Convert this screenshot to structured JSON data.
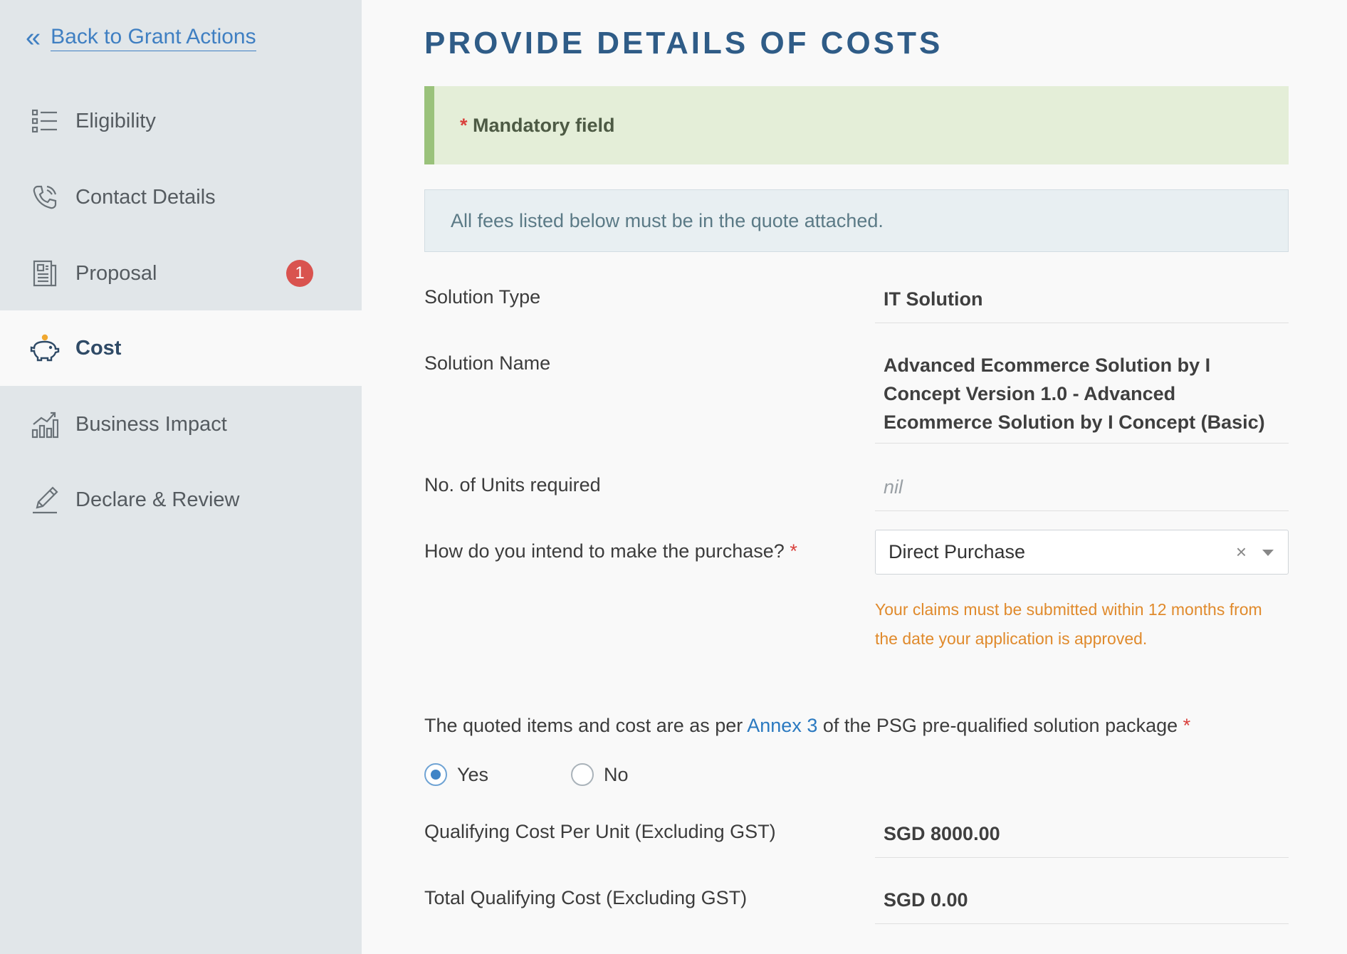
{
  "sidebar": {
    "back_label": "Back to Grant Actions",
    "items": [
      {
        "label": "Eligibility",
        "icon": "list-icon"
      },
      {
        "label": "Contact Details",
        "icon": "phone-icon"
      },
      {
        "label": "Proposal",
        "icon": "document-icon",
        "badge": "1"
      },
      {
        "label": "Cost",
        "icon": "piggy-bank-icon",
        "active": true
      },
      {
        "label": "Business Impact",
        "icon": "bar-chart-icon"
      },
      {
        "label": "Declare & Review",
        "icon": "pen-icon"
      }
    ]
  },
  "main": {
    "title": "PROVIDE DETAILS OF COSTS",
    "mandatory": {
      "star": "*",
      "text": "Mandatory field"
    },
    "info": "All fees listed below must be in the quote attached.",
    "fields": {
      "solution_type": {
        "label": "Solution Type",
        "value": "IT Solution"
      },
      "solution_name": {
        "label": "Solution Name",
        "value": "Advanced Ecommerce Solution by I Concept Version 1.0 - Advanced Ecommerce Solution by I Concept (Basic)"
      },
      "units": {
        "label": "No. of Units required",
        "value": "nil"
      },
      "purchase": {
        "label": "How do you intend to make the purchase?",
        "star": "*",
        "value": "Direct Purchase",
        "clear": "×"
      },
      "warning": "Your claims must be submitted within 12 months from the date your application is approved.",
      "quoted": {
        "text_before": "The quoted items and cost are as per ",
        "link": "Annex 3",
        "text_after": " of the PSG pre-qualified solution package ",
        "star": "*",
        "options": [
          "Yes",
          "No"
        ],
        "selected": "Yes"
      },
      "cost_per_unit": {
        "label": "Qualifying Cost Per Unit (Excluding GST)",
        "value": "SGD 8000.00"
      },
      "total_cost": {
        "label": "Total Qualifying Cost (Excluding GST)",
        "value": "SGD 0.00"
      }
    }
  },
  "colors": {
    "accent": "#2f5c87",
    "link": "#2a79c0",
    "warning": "#e08a2c",
    "required": "#d9413d",
    "badge": "#d9534f"
  }
}
